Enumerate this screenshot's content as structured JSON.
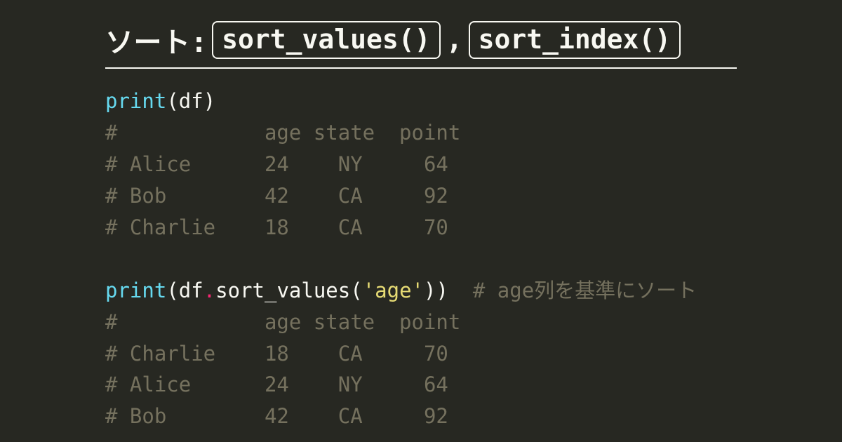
{
  "title": {
    "prefix": "ソート:",
    "fn1": "sort_values()",
    "sep": ",",
    "fn2": "sort_index()"
  },
  "code1": {
    "print": "print",
    "lp": "(",
    "df": "df",
    "rp": ")"
  },
  "out1": {
    "l1": "#            age state  point",
    "l2": "# Alice      24    NY     64",
    "l3": "# Bob        42    CA     92",
    "l4": "# Charlie    18    CA     70"
  },
  "code2": {
    "print": "print",
    "lp": "(",
    "df": "df",
    "dot": ".",
    "method": "sort_values",
    "lp2": "(",
    "arg": "'age'",
    "rp2": ")",
    "rp": ")",
    "comment": "  # age列を基準にソート"
  },
  "out2": {
    "l1": "#            age state  point",
    "l2": "# Charlie    18    CA     70",
    "l3": "# Alice      24    NY     64",
    "l4": "# Bob        42    CA     92"
  }
}
